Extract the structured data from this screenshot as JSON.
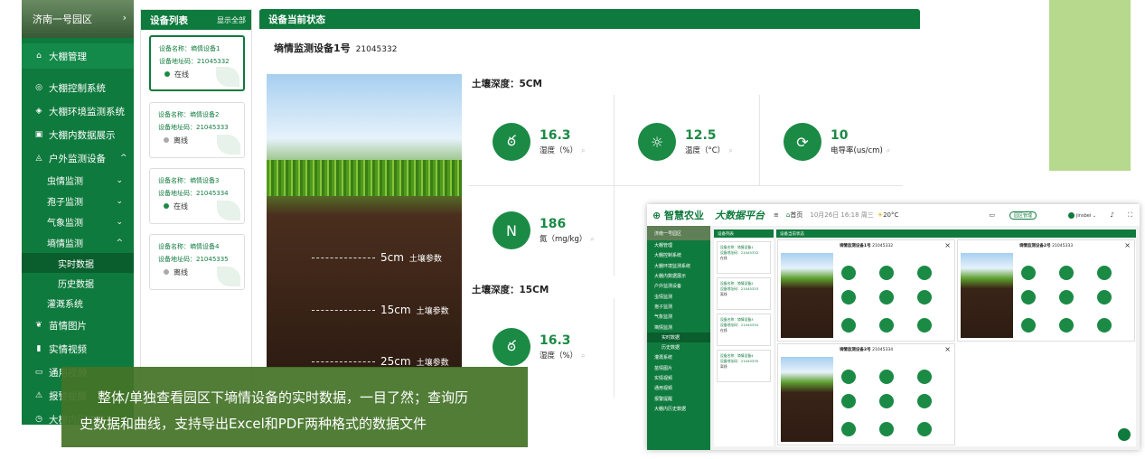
{
  "sidebar": {
    "park": "济南一号园区",
    "chevron": "›",
    "top": "大棚管理",
    "items": [
      "大棚控制系统",
      "大棚环境监测系统",
      "大棚内数据展示",
      "户外监测设备"
    ],
    "subs": [
      "虫情监测",
      "孢子监测",
      "气象监测",
      "墒情监测"
    ],
    "leaves": [
      "实时数据",
      "历史数据"
    ],
    "rest": [
      "灌溉系统",
      "苗情图片",
      "实情视频",
      "通用视频",
      "报警提醒",
      "大棚内历史数据"
    ]
  },
  "devlist": {
    "title": "设备列表",
    "show_all": "显示全部",
    "devices": [
      {
        "name": "设备名称：墒情设备1",
        "addr": "设备地址码：21045332",
        "status": "在线",
        "color": "#1b8a45"
      },
      {
        "name": "设备名称：墒情设备2",
        "addr": "设备地址码：21045333",
        "status": "离线",
        "color": "#aaaaaa"
      },
      {
        "name": "设备名称：墒情设备3",
        "addr": "设备地址码：21045334",
        "status": "在线",
        "color": "#1b8a45"
      },
      {
        "name": "设备名称：墒情设备4",
        "addr": "设备地址码：21045335",
        "status": "离线",
        "color": "#aaaaaa"
      }
    ]
  },
  "main": {
    "title": "设备当前状态",
    "device": "墒情监测设备1号",
    "device_id": "21045332",
    "depths": [
      {
        "d": "5cm",
        "l": "土壤参数"
      },
      {
        "d": "15cm",
        "l": "土壤参数"
      },
      {
        "d": "25cm",
        "l": "土壤参数"
      }
    ],
    "sec1": "土壤深度：5CM",
    "sec2": "土壤深度：15CM",
    "metrics": [
      {
        "v": "16.3",
        "u": "湿度（%）",
        "icon": "drop-icon",
        "glyph": "ఠ"
      },
      {
        "v": "12.5",
        "u": "温度（°C）",
        "icon": "thermometer-icon",
        "glyph": "☼"
      },
      {
        "v": "10",
        "u": "电导率(us/cm)",
        "icon": "conductivity-icon",
        "glyph": "⟳"
      },
      {
        "v": "186",
        "u": "氮（mg/kg）",
        "icon": "nitrogen-icon",
        "glyph": "N"
      },
      {
        "v": "16.3",
        "u": "湿度（%）",
        "icon": "drop-icon",
        "glyph": "ఠ"
      }
    ]
  },
  "overlay": {
    "line1": "整体/单独查看园区下墒情设备的实时数据，一目了然；查询历",
    "line2": "史数据和曲线，支持导出Excel和PDF两种格式的数据文件"
  },
  "mini": {
    "logo": "智慧农业",
    "platform": "大数据平台",
    "home": "首页",
    "date": "10月26日 16:18 周三",
    "temp": "20°C",
    "btn": "园区管理",
    "user": "jinsbei",
    "panels": [
      {
        "t": "墒情监测设备1号",
        "id": "21045332"
      },
      {
        "t": "墒情监测设备2号",
        "id": "21045333"
      },
      {
        "t": "墒情监测设备3号",
        "id": "21045334"
      }
    ]
  }
}
